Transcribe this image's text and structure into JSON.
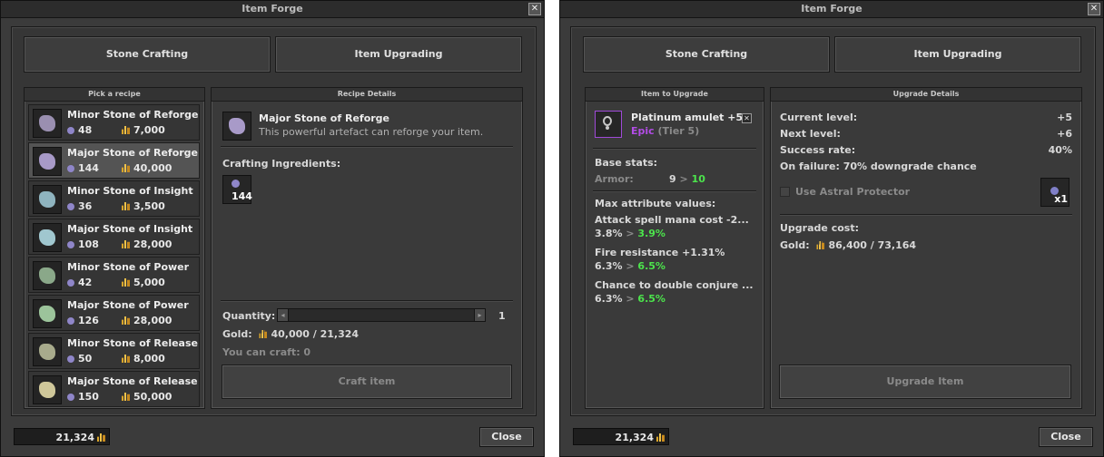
{
  "left_window": {
    "title": "Item Forge",
    "tabs": [
      "Stone Crafting",
      "Item Upgrading"
    ],
    "recipe_list_title": "Pick a recipe",
    "recipes": [
      {
        "name": "Minor Stone of Reforge",
        "stones": "48",
        "gold": "7,000",
        "color": "#9a8fb0",
        "selected": false
      },
      {
        "name": "Major Stone of Reforge",
        "stones": "144",
        "gold": "40,000",
        "color": "#a89ac8",
        "selected": true
      },
      {
        "name": "Minor Stone of Insight",
        "stones": "36",
        "gold": "3,500",
        "color": "#8fb4bf",
        "selected": false
      },
      {
        "name": "Major Stone of Insight",
        "stones": "108",
        "gold": "28,000",
        "color": "#a0c7cf",
        "selected": false
      },
      {
        "name": "Minor Stone of Power",
        "stones": "42",
        "gold": "5,000",
        "color": "#8aa889",
        "selected": false
      },
      {
        "name": "Major Stone of Power",
        "stones": "126",
        "gold": "28,000",
        "color": "#9cc49b",
        "selected": false
      },
      {
        "name": "Minor Stone of Release",
        "stones": "50",
        "gold": "8,000",
        "color": "#a8ab8c",
        "selected": false
      },
      {
        "name": "Major Stone of Release",
        "stones": "150",
        "gold": "50,000",
        "color": "#cfc79a",
        "selected": false
      }
    ],
    "details_title": "Recipe Details",
    "detail_name": "Major Stone of Reforge",
    "detail_desc": "This powerful artefact can reforge your item.",
    "ingredients_label": "Crafting Ingredients:",
    "ingredient_count": "144",
    "quantity_label": "Quantity:",
    "quantity_value": "1",
    "gold_label": "Gold:",
    "gold_value": "40,000 / 21,324",
    "can_craft": "You can craft: 0",
    "craft_button": "Craft item",
    "player_gold": "21,324",
    "close_button": "Close"
  },
  "right_window": {
    "title": "Item Forge",
    "tabs": [
      "Stone Crafting",
      "Item Upgrading"
    ],
    "item_panel_title": "Item to Upgrade",
    "item_name": "Platinum amulet +5",
    "item_rarity": "Epic",
    "item_tier": "(Tier 5)",
    "base_stats_label": "Base stats:",
    "armor_label": "Armor:",
    "armor_from": "9",
    "armor_to": "10",
    "max_attr_label": "Max attribute values:",
    "attributes": [
      {
        "name": "Attack spell mana cost -2...",
        "from": "3.8%",
        "to": "3.9%"
      },
      {
        "name": "Fire resistance +1.31%",
        "from": "6.3%",
        "to": "6.5%"
      },
      {
        "name": "Chance to double conjure ...",
        "from": "6.3%",
        "to": "6.5%"
      }
    ],
    "upgrade_panel_title": "Upgrade Details",
    "current_level_label": "Current level:",
    "current_level": "+5",
    "next_level_label": "Next level:",
    "next_level": "+6",
    "success_label": "Success rate:",
    "success_rate": "40%",
    "failure_text": "On failure: 70% downgrade chance",
    "protector_label": "Use Astral Protector",
    "protector_count": "x1",
    "upgrade_cost_label": "Upgrade cost:",
    "gold_label": "Gold:",
    "gold_value": "86,400 / 73,164",
    "upgrade_button": "Upgrade Item",
    "player_gold": "21,324",
    "close_button": "Close"
  },
  "separator": ">"
}
